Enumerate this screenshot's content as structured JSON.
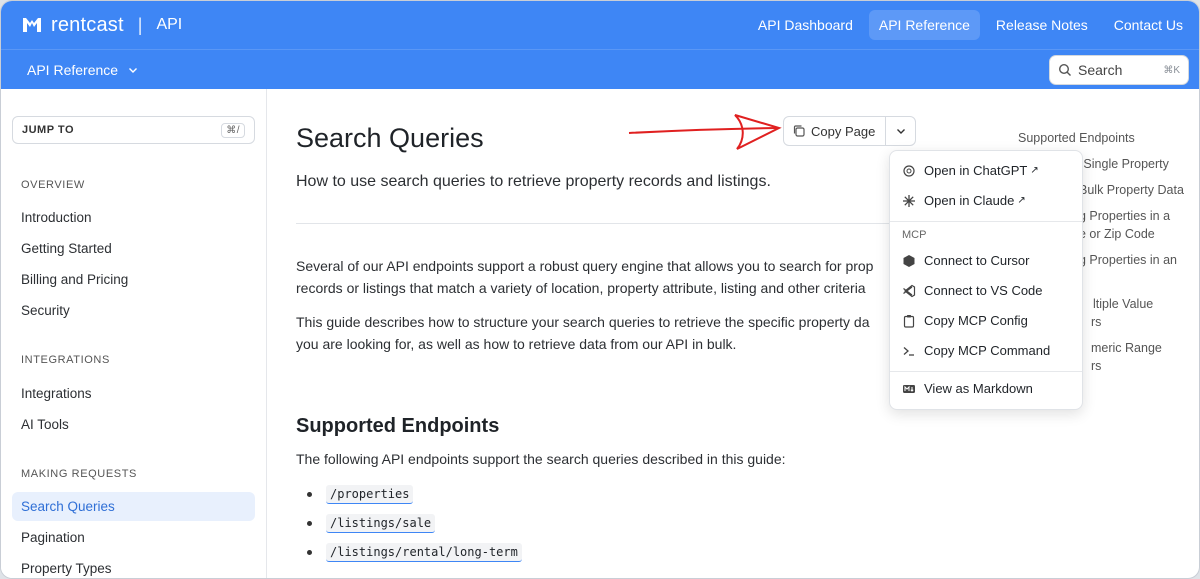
{
  "header": {
    "brand": "rentcast",
    "separator": "|",
    "product": "API",
    "nav": [
      "API Dashboard",
      "API Reference",
      "Release Notes",
      "Contact Us"
    ],
    "accent": "#3e86f5"
  },
  "subbar": {
    "section_select": "API Reference",
    "search_label": "Search",
    "search_shortcut": "⌘K"
  },
  "sidebar": {
    "jump_to": "JUMP TO",
    "jump_shortcut": "⌘/",
    "sections": [
      {
        "title": "OVERVIEW",
        "items": [
          "Introduction",
          "Getting Started",
          "Billing and Pricing",
          "Security"
        ]
      },
      {
        "title": "INTEGRATIONS",
        "items": [
          "Integrations",
          "AI Tools"
        ]
      },
      {
        "title": "MAKING REQUESTS",
        "items": [
          "Search Queries",
          "Pagination",
          "Property Types"
        ]
      }
    ],
    "active_item": "Search Queries"
  },
  "main": {
    "title": "Search Queries",
    "subtitle": "How to use search queries to retrieve property records and listings.",
    "copy_page": "Copy Page",
    "para1_line1": "Several of our API endpoints support a robust query engine that allows you to search for prop",
    "para1_line2": "records or listings that match a variety of location, property attribute, listing and other criteria",
    "para2_line1": "This guide describes how to structure your search queries to retrieve the specific property da",
    "para2_line2": "you are looking for, as well as how to retrieve data from our API in bulk.",
    "h2": "Supported Endpoints",
    "h2_text": "The following API endpoints support the search queries described in this guide:",
    "endpoints": [
      "/properties",
      "/listings/sale",
      "/listings/rental/long-term"
    ]
  },
  "toc": {
    "items": [
      "Supported Endpoints",
      "a Single Property",
      "Bulk Property Data",
      "g Properties in a",
      "e or Zip Code",
      "g Properties in an",
      "ltiple Value",
      "rs",
      "meric Range",
      "rs"
    ]
  },
  "dropdown": {
    "items_top": [
      "Open in ChatGPT",
      "Open in Claude"
    ],
    "mcp_label": "MCP",
    "items_mcp": [
      "Connect to Cursor",
      "Connect to VS Code",
      "Copy MCP Config",
      "Copy MCP Command"
    ],
    "item_bottom": "View as Markdown",
    "ext_mark": "↗"
  }
}
